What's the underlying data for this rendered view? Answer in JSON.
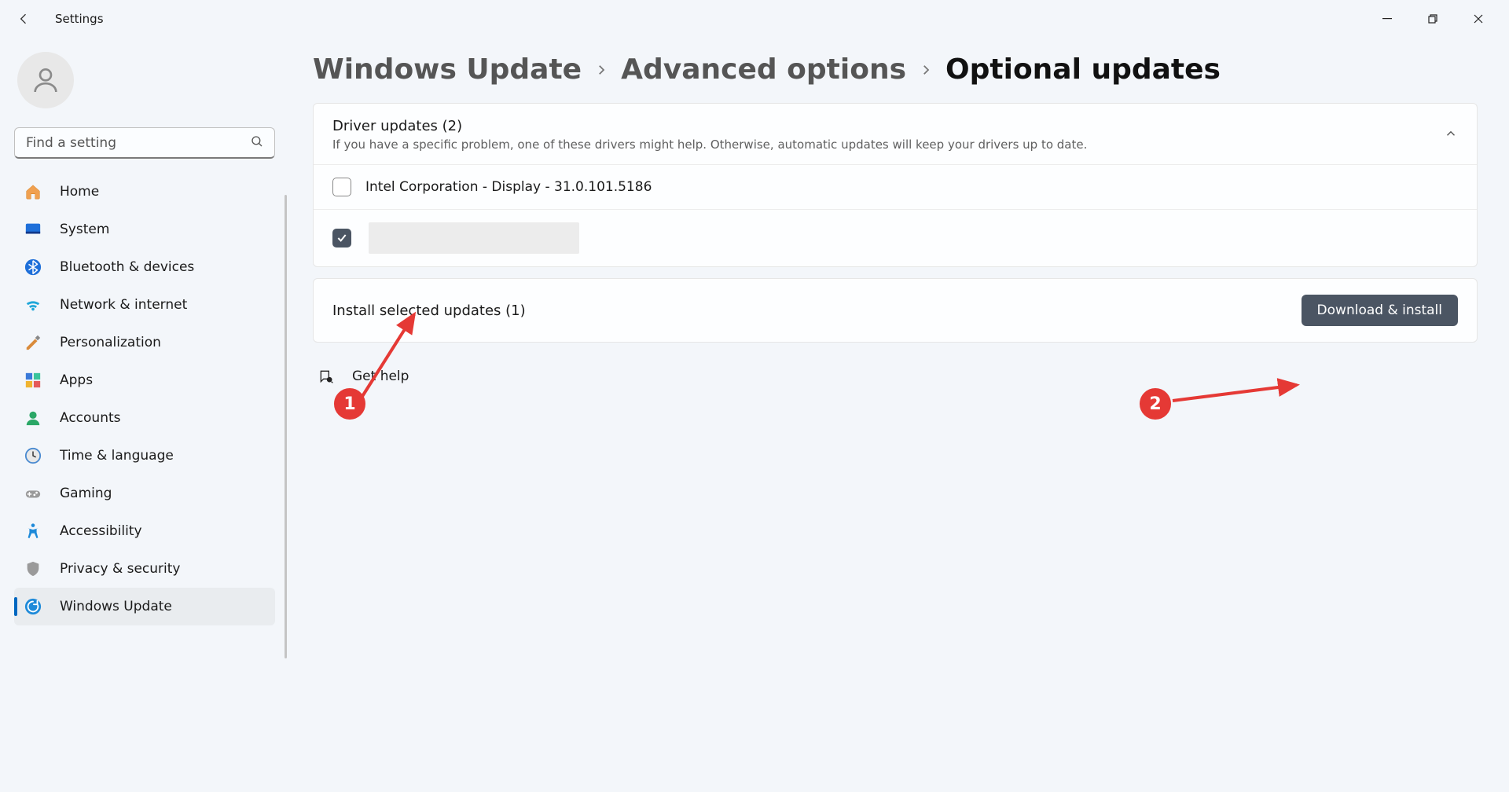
{
  "window": {
    "app_title": "Settings"
  },
  "sidebar": {
    "search_placeholder": "Find a setting",
    "items": [
      {
        "label": "Home",
        "icon": "home"
      },
      {
        "label": "System",
        "icon": "system"
      },
      {
        "label": "Bluetooth & devices",
        "icon": "bluetooth"
      },
      {
        "label": "Network & internet",
        "icon": "network"
      },
      {
        "label": "Personalization",
        "icon": "personalization"
      },
      {
        "label": "Apps",
        "icon": "apps"
      },
      {
        "label": "Accounts",
        "icon": "accounts"
      },
      {
        "label": "Time & language",
        "icon": "time"
      },
      {
        "label": "Gaming",
        "icon": "gaming"
      },
      {
        "label": "Accessibility",
        "icon": "accessibility"
      },
      {
        "label": "Privacy & security",
        "icon": "privacy"
      },
      {
        "label": "Windows Update",
        "icon": "update",
        "active": true
      }
    ]
  },
  "breadcrumb": {
    "level1": "Windows Update",
    "level2": "Advanced options",
    "current": "Optional updates"
  },
  "section": {
    "title": "Driver updates (2)",
    "description": "If you have a specific problem, one of these drivers might help. Otherwise, automatic updates will keep your drivers up to date."
  },
  "drivers": [
    {
      "label": "Intel Corporation - Display - 31.0.101.5186",
      "checked": false
    },
    {
      "label": "",
      "checked": true,
      "redacted": true
    }
  ],
  "install": {
    "label": "Install selected updates (1)",
    "button": "Download & install"
  },
  "help": {
    "label": "Get help"
  },
  "annotations": {
    "badge1": "1",
    "badge2": "2"
  }
}
